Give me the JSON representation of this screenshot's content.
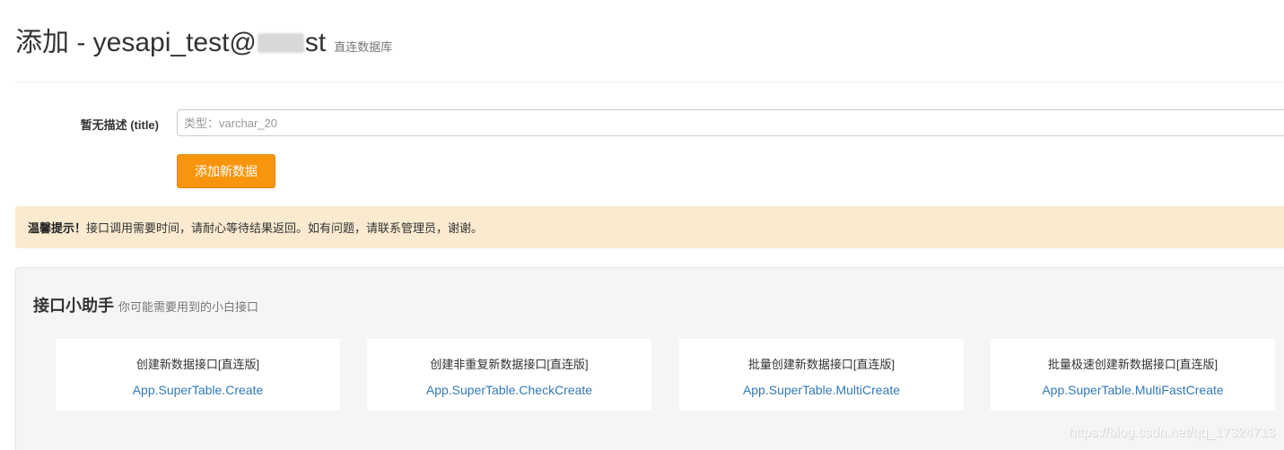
{
  "header": {
    "title_prefix": "添加 - yesapi_test@",
    "title_suffix": "st",
    "subtitle": "直连数据库"
  },
  "form": {
    "field_label": "暂无描述 (title)",
    "field_placeholder": "类型：varchar_20",
    "field_value": "",
    "submit_label": "添加新数据",
    "submit_color": "#f7950e"
  },
  "alert": {
    "strong_text": "温馨提示！",
    "message": "接口调用需要时间，请耐心等待结果返回。如有问题，请联系管理员，谢谢。",
    "background_color": "#f9ead0"
  },
  "helper": {
    "title": "接口小助手",
    "subtitle": "你可能需要用到的小白接口",
    "cards": [
      {
        "name": "创建新数据接口[直连版]",
        "link": "App.SuperTable.Create"
      },
      {
        "name": "创建非重复新数据接口[直连版]",
        "link": "App.SuperTable.CheckCreate"
      },
      {
        "name": "批量创建新数据接口[直连版]",
        "link": "App.SuperTable.MultiCreate"
      },
      {
        "name": "批量极速创建新数据接口[直连版]",
        "link": "App.SuperTable.MultiFastCreate"
      }
    ],
    "link_color": "#337ab7"
  },
  "watermark": "https://blog.csdn.net/qq_17324713"
}
